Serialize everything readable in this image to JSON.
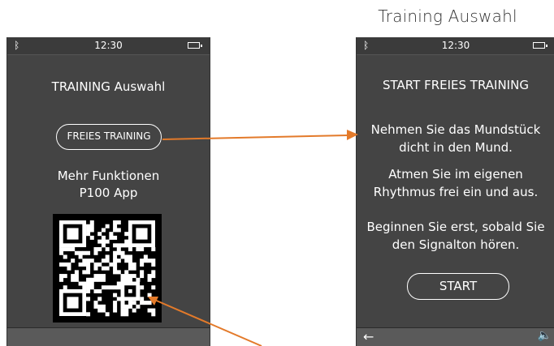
{
  "page": {
    "title": "Training Auswahl"
  },
  "screen1": {
    "status": {
      "time": "12:30",
      "bluetooth_glyph": "ᛒ"
    },
    "title": "TRAINING Auswahl",
    "button_label": "FREIES TRAINING",
    "more_functions_line1": "Mehr Funktionen",
    "more_functions_line2": "P100 App"
  },
  "screen2": {
    "status": {
      "time": "12:30",
      "bluetooth_glyph": "ᛒ"
    },
    "title": "START FREIES TRAINING",
    "instruction1_line1": "Nehmen Sie das Mundstück",
    "instruction1_line2": "dicht in den Mund.",
    "instruction2_line1": "Atmen Sie im eigenen",
    "instruction2_line2": "Rhythmus frei ein und aus.",
    "instruction3_line1": "Beginnen Sie erst, sobald Sie",
    "instruction3_line2": "den Signalton hören.",
    "start_label": "START",
    "back_glyph": "←",
    "volume_glyph": "🔈"
  },
  "colors": {
    "arrow": "#e37a2a",
    "device": "#444444"
  }
}
